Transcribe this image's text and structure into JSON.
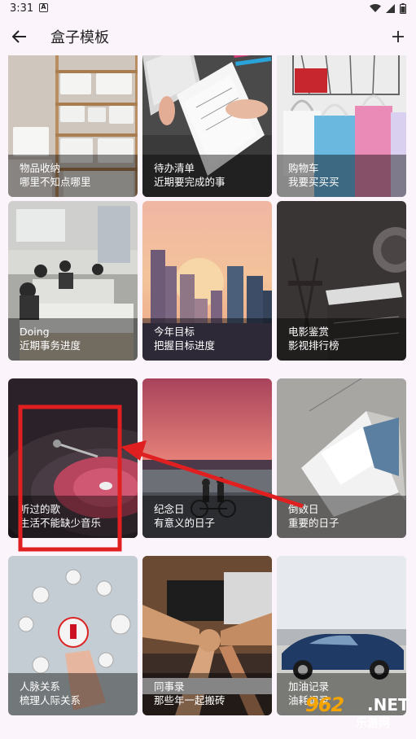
{
  "status_bar": {
    "time": "3:31",
    "notification_icon": "A"
  },
  "app_bar": {
    "title": "盒子模板"
  },
  "cards": [
    {
      "title": "物品收纳",
      "subtitle": "哪里不知点哪里"
    },
    {
      "title": "待办清单",
      "subtitle": "近期要完成的事"
    },
    {
      "title": "购物车",
      "subtitle": "我要买买买"
    },
    {
      "title": "Doing",
      "subtitle": "近期事务进度"
    },
    {
      "title": "今年目标",
      "subtitle": "把握目标进度"
    },
    {
      "title": "电影鉴赏",
      "subtitle": "影视排行榜"
    },
    {
      "title": "听过的歌",
      "subtitle": "生活不能缺少音乐"
    },
    {
      "title": "纪念日",
      "subtitle": "有意义的日子"
    },
    {
      "title": "倒数日",
      "subtitle": "重要的日子"
    },
    {
      "title": "人脉关系",
      "subtitle": "梳理人际关系"
    },
    {
      "title": "同事录",
      "subtitle": "那些年一起搬砖"
    },
    {
      "title": "加油记录",
      "subtitle": "油耗记录"
    }
  ],
  "watermark": {
    "logo": "962",
    "suffix": ".NET",
    "sub": "乐游网"
  },
  "colors": {
    "background": "#fbf4fa",
    "annotation_red": "#e02020",
    "caption_overlay": "rgba(0,0,0,0.42)"
  }
}
